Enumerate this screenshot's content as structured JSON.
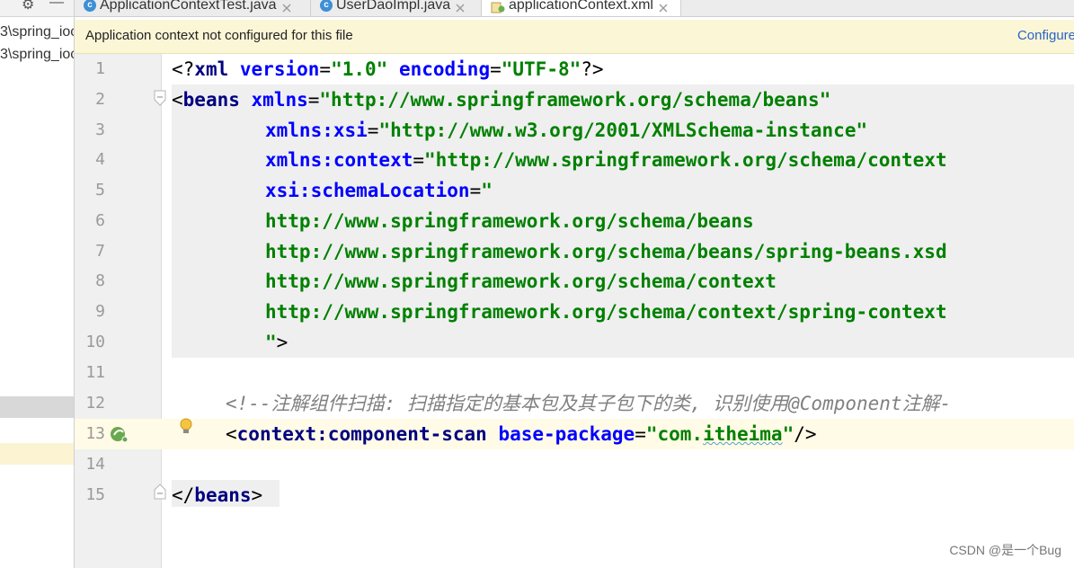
{
  "left_pane": {
    "tree_items": [
      "3\\spring_ioc",
      "3\\spring_ioc"
    ]
  },
  "tabs": [
    {
      "label": "ApplicationContextTest.java",
      "icon": "java-class-icon",
      "active": false
    },
    {
      "label": "UserDaoImpl.java",
      "icon": "java-class-icon",
      "active": false
    },
    {
      "label": "applicationContext.xml",
      "icon": "xml-file-icon",
      "active": true
    }
  ],
  "notice": {
    "text": "Application context not configured for this file",
    "link": "Configure"
  },
  "editor": {
    "line_numbers": [
      "1",
      "2",
      "3",
      "4",
      "5",
      "6",
      "7",
      "8",
      "9",
      "10",
      "11",
      "12",
      "13",
      "14",
      "15"
    ],
    "lines": {
      "l1": {
        "lt": "<?",
        "name": "xml",
        "a1": "version",
        "eq1": "=",
        "v1": "\"1.0\"",
        "a2": "encoding",
        "eq2": "=",
        "v2": "\"UTF-8\"",
        "end": "?>"
      },
      "l2": {
        "lt": "<",
        "tag": "beans",
        "attr": "xmlns",
        "eq": "=",
        "val": "\"http://www.springframework.org/schema/beans\""
      },
      "l3": {
        "attr": "xmlns:xsi",
        "eq": "=",
        "val": "\"http://www.w3.org/2001/XMLSchema-instance\""
      },
      "l4": {
        "attr": "xmlns:context",
        "eq": "=",
        "val": "\"http://www.springframework.org/schema/context"
      },
      "l5": {
        "attr": "xsi:schemaLocation",
        "eq": "=",
        "val": "\""
      },
      "l6": {
        "val": "http://www.springframework.org/schema/beans"
      },
      "l7": {
        "val": "http://www.springframework.org/schema/beans/spring-beans.xsd"
      },
      "l8": {
        "val": "http://www.springframework.org/schema/context"
      },
      "l9": {
        "val": "http://www.springframework.org/schema/context/spring-context"
      },
      "l10": {
        "val": "\"",
        "end": ">"
      },
      "l12": {
        "comment": "<!--注解组件扫描: 扫描指定的基本包及其子包下的类, 识别使用@Component注解-"
      },
      "l13": {
        "lt": "<",
        "tag": "context:component-scan",
        "attr": "base-package",
        "eq": "=",
        "q1": "\"",
        "v1": "com.",
        "v2": "itheima",
        "q2": "\"",
        "end": "/>"
      },
      "l15": {
        "lt": "</",
        "tag": "beans",
        "end": ">"
      }
    }
  },
  "watermark": "CSDN @是一个Bug",
  "colors": {
    "tag": "#000080",
    "attribute": "#0000ff",
    "value": "#008000",
    "comment": "#808080",
    "notice_bg": "#fbf6d6",
    "current_line": "#fffbe6",
    "link": "#2b62c9"
  }
}
